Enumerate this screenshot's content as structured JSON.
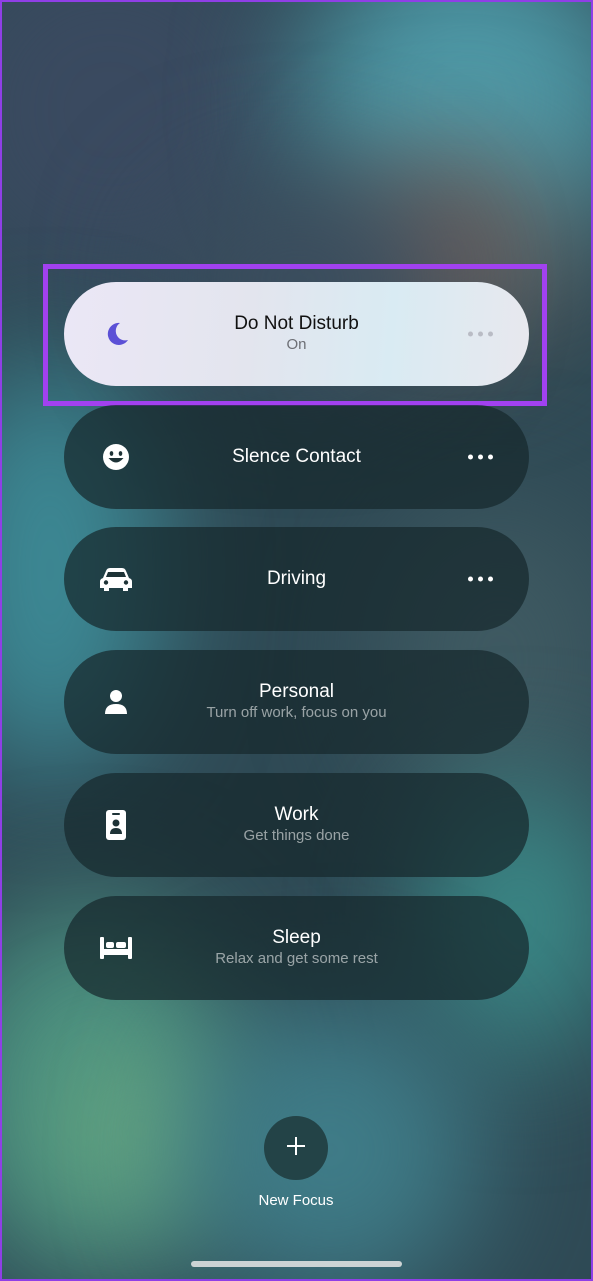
{
  "focus_modes": [
    {
      "title": "Do Not Disturb",
      "subtitle": "On",
      "icon": "moon-icon"
    },
    {
      "title": "Slence Contact",
      "subtitle": "",
      "icon": "smiley-face-icon"
    },
    {
      "title": "Driving",
      "subtitle": "",
      "icon": "car-icon"
    },
    {
      "title": "Personal",
      "subtitle": "Turn off work, focus on you",
      "icon": "person-icon"
    },
    {
      "title": "Work",
      "subtitle": "Get things done",
      "icon": "id-badge-icon"
    },
    {
      "title": "Sleep",
      "subtitle": "Relax and get some rest",
      "icon": "bed-icon"
    }
  ],
  "new_focus": {
    "label": "New Focus",
    "icon": "plus-icon"
  },
  "colors": {
    "highlight_border": "#a241f0",
    "moon_accent": "#5b50d6",
    "active_card": "#e4e6ef"
  }
}
